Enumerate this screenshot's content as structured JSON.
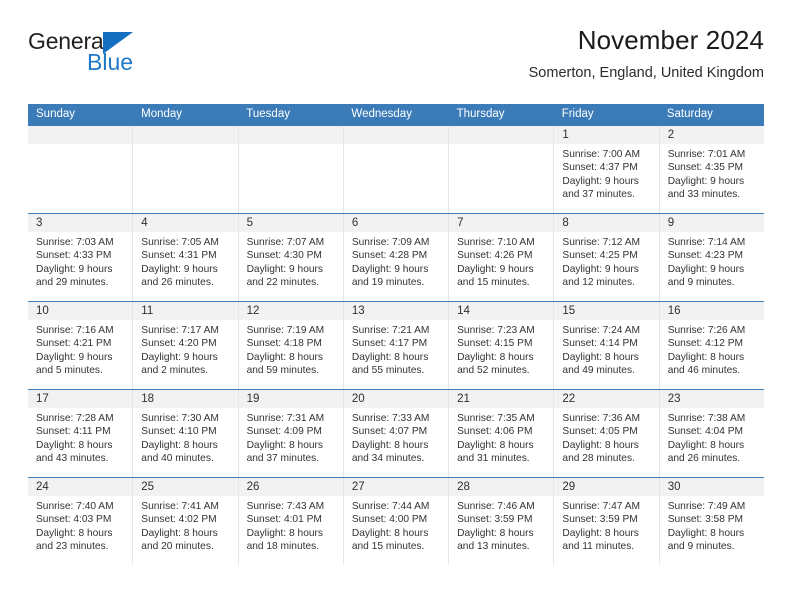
{
  "brand": {
    "name_top": "General",
    "name_bottom": "Blue",
    "triangle_icon": "blue-triangle-logo-icon",
    "accent_color": "#1f79c8"
  },
  "header": {
    "title": "November 2024",
    "subtitle": "Somerton, England, United Kingdom"
  },
  "colors": {
    "header_row_blue": "#3b7cb8",
    "day_header_gray": "#f2f2f2",
    "text": "#333333"
  },
  "weekdays": [
    "Sunday",
    "Monday",
    "Tuesday",
    "Wednesday",
    "Thursday",
    "Friday",
    "Saturday"
  ],
  "weeks": [
    [
      {
        "day": "",
        "empty": true
      },
      {
        "day": "",
        "empty": true
      },
      {
        "day": "",
        "empty": true
      },
      {
        "day": "",
        "empty": true
      },
      {
        "day": "",
        "empty": true
      },
      {
        "day": "1",
        "sunrise": "Sunrise: 7:00 AM",
        "sunset": "Sunset: 4:37 PM",
        "daylight1": "Daylight: 9 hours",
        "daylight2": "and 37 minutes."
      },
      {
        "day": "2",
        "sunrise": "Sunrise: 7:01 AM",
        "sunset": "Sunset: 4:35 PM",
        "daylight1": "Daylight: 9 hours",
        "daylight2": "and 33 minutes."
      }
    ],
    [
      {
        "day": "3",
        "sunrise": "Sunrise: 7:03 AM",
        "sunset": "Sunset: 4:33 PM",
        "daylight1": "Daylight: 9 hours",
        "daylight2": "and 29 minutes."
      },
      {
        "day": "4",
        "sunrise": "Sunrise: 7:05 AM",
        "sunset": "Sunset: 4:31 PM",
        "daylight1": "Daylight: 9 hours",
        "daylight2": "and 26 minutes."
      },
      {
        "day": "5",
        "sunrise": "Sunrise: 7:07 AM",
        "sunset": "Sunset: 4:30 PM",
        "daylight1": "Daylight: 9 hours",
        "daylight2": "and 22 minutes."
      },
      {
        "day": "6",
        "sunrise": "Sunrise: 7:09 AM",
        "sunset": "Sunset: 4:28 PM",
        "daylight1": "Daylight: 9 hours",
        "daylight2": "and 19 minutes."
      },
      {
        "day": "7",
        "sunrise": "Sunrise: 7:10 AM",
        "sunset": "Sunset: 4:26 PM",
        "daylight1": "Daylight: 9 hours",
        "daylight2": "and 15 minutes."
      },
      {
        "day": "8",
        "sunrise": "Sunrise: 7:12 AM",
        "sunset": "Sunset: 4:25 PM",
        "daylight1": "Daylight: 9 hours",
        "daylight2": "and 12 minutes."
      },
      {
        "day": "9",
        "sunrise": "Sunrise: 7:14 AM",
        "sunset": "Sunset: 4:23 PM",
        "daylight1": "Daylight: 9 hours",
        "daylight2": "and 9 minutes."
      }
    ],
    [
      {
        "day": "10",
        "sunrise": "Sunrise: 7:16 AM",
        "sunset": "Sunset: 4:21 PM",
        "daylight1": "Daylight: 9 hours",
        "daylight2": "and 5 minutes."
      },
      {
        "day": "11",
        "sunrise": "Sunrise: 7:17 AM",
        "sunset": "Sunset: 4:20 PM",
        "daylight1": "Daylight: 9 hours",
        "daylight2": "and 2 minutes."
      },
      {
        "day": "12",
        "sunrise": "Sunrise: 7:19 AM",
        "sunset": "Sunset: 4:18 PM",
        "daylight1": "Daylight: 8 hours",
        "daylight2": "and 59 minutes."
      },
      {
        "day": "13",
        "sunrise": "Sunrise: 7:21 AM",
        "sunset": "Sunset: 4:17 PM",
        "daylight1": "Daylight: 8 hours",
        "daylight2": "and 55 minutes."
      },
      {
        "day": "14",
        "sunrise": "Sunrise: 7:23 AM",
        "sunset": "Sunset: 4:15 PM",
        "daylight1": "Daylight: 8 hours",
        "daylight2": "and 52 minutes."
      },
      {
        "day": "15",
        "sunrise": "Sunrise: 7:24 AM",
        "sunset": "Sunset: 4:14 PM",
        "daylight1": "Daylight: 8 hours",
        "daylight2": "and 49 minutes."
      },
      {
        "day": "16",
        "sunrise": "Sunrise: 7:26 AM",
        "sunset": "Sunset: 4:12 PM",
        "daylight1": "Daylight: 8 hours",
        "daylight2": "and 46 minutes."
      }
    ],
    [
      {
        "day": "17",
        "sunrise": "Sunrise: 7:28 AM",
        "sunset": "Sunset: 4:11 PM",
        "daylight1": "Daylight: 8 hours",
        "daylight2": "and 43 minutes."
      },
      {
        "day": "18",
        "sunrise": "Sunrise: 7:30 AM",
        "sunset": "Sunset: 4:10 PM",
        "daylight1": "Daylight: 8 hours",
        "daylight2": "and 40 minutes."
      },
      {
        "day": "19",
        "sunrise": "Sunrise: 7:31 AM",
        "sunset": "Sunset: 4:09 PM",
        "daylight1": "Daylight: 8 hours",
        "daylight2": "and 37 minutes."
      },
      {
        "day": "20",
        "sunrise": "Sunrise: 7:33 AM",
        "sunset": "Sunset: 4:07 PM",
        "daylight1": "Daylight: 8 hours",
        "daylight2": "and 34 minutes."
      },
      {
        "day": "21",
        "sunrise": "Sunrise: 7:35 AM",
        "sunset": "Sunset: 4:06 PM",
        "daylight1": "Daylight: 8 hours",
        "daylight2": "and 31 minutes."
      },
      {
        "day": "22",
        "sunrise": "Sunrise: 7:36 AM",
        "sunset": "Sunset: 4:05 PM",
        "daylight1": "Daylight: 8 hours",
        "daylight2": "and 28 minutes."
      },
      {
        "day": "23",
        "sunrise": "Sunrise: 7:38 AM",
        "sunset": "Sunset: 4:04 PM",
        "daylight1": "Daylight: 8 hours",
        "daylight2": "and 26 minutes."
      }
    ],
    [
      {
        "day": "24",
        "sunrise": "Sunrise: 7:40 AM",
        "sunset": "Sunset: 4:03 PM",
        "daylight1": "Daylight: 8 hours",
        "daylight2": "and 23 minutes."
      },
      {
        "day": "25",
        "sunrise": "Sunrise: 7:41 AM",
        "sunset": "Sunset: 4:02 PM",
        "daylight1": "Daylight: 8 hours",
        "daylight2": "and 20 minutes."
      },
      {
        "day": "26",
        "sunrise": "Sunrise: 7:43 AM",
        "sunset": "Sunset: 4:01 PM",
        "daylight1": "Daylight: 8 hours",
        "daylight2": "and 18 minutes."
      },
      {
        "day": "27",
        "sunrise": "Sunrise: 7:44 AM",
        "sunset": "Sunset: 4:00 PM",
        "daylight1": "Daylight: 8 hours",
        "daylight2": "and 15 minutes."
      },
      {
        "day": "28",
        "sunrise": "Sunrise: 7:46 AM",
        "sunset": "Sunset: 3:59 PM",
        "daylight1": "Daylight: 8 hours",
        "daylight2": "and 13 minutes."
      },
      {
        "day": "29",
        "sunrise": "Sunrise: 7:47 AM",
        "sunset": "Sunset: 3:59 PM",
        "daylight1": "Daylight: 8 hours",
        "daylight2": "and 11 minutes."
      },
      {
        "day": "30",
        "sunrise": "Sunrise: 7:49 AM",
        "sunset": "Sunset: 3:58 PM",
        "daylight1": "Daylight: 8 hours",
        "daylight2": "and 9 minutes."
      }
    ]
  ]
}
